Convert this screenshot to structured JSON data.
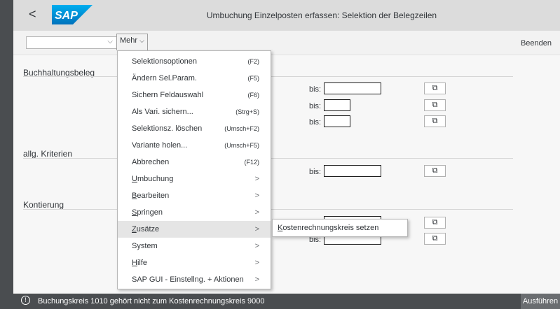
{
  "window": {
    "title": "Umbuchung Einzelposten erfassen: Selektion der Belegzeilen",
    "logo_text": "SAP"
  },
  "toolbar": {
    "dropdown_value": "",
    "mehr_label": "Mehr",
    "beenden_label": "Beenden"
  },
  "sections": {
    "buchhaltungsbeleg": "Buchhaltungsbeleg",
    "allg_kriterien": "allg. Kriterien",
    "kontierung": "Kontierung"
  },
  "bis_label": "bis:",
  "menu": {
    "items": [
      {
        "label": "Selektionsoptionen",
        "shortcut": "(F2)",
        "submenu": false,
        "mnemonic": ""
      },
      {
        "label": "Ändern Sel.Param.",
        "shortcut": "(F5)",
        "submenu": false,
        "mnemonic": ""
      },
      {
        "label": "Sichern Feldauswahl",
        "shortcut": "(F6)",
        "submenu": false,
        "mnemonic": ""
      },
      {
        "label": "Als Vari. sichern...",
        "shortcut": "(Strg+S)",
        "submenu": false,
        "mnemonic": ""
      },
      {
        "label": "Selektionsz. löschen",
        "shortcut": "(Umsch+F2)",
        "submenu": false,
        "mnemonic": ""
      },
      {
        "label": "Variante holen...",
        "shortcut": "(Umsch+F5)",
        "submenu": false,
        "mnemonic": ""
      },
      {
        "label": "Abbrechen",
        "shortcut": "(F12)",
        "submenu": false,
        "mnemonic": ""
      },
      {
        "label": "Umbuchung",
        "shortcut": "",
        "submenu": true,
        "mnemonic": "U"
      },
      {
        "label": "Bearbeiten",
        "shortcut": "",
        "submenu": true,
        "mnemonic": "B"
      },
      {
        "label": "Springen",
        "shortcut": "",
        "submenu": true,
        "mnemonic": "S"
      },
      {
        "label": "Zusätze",
        "shortcut": "",
        "submenu": true,
        "mnemonic": "Z",
        "highlighted": true
      },
      {
        "label": "System",
        "shortcut": "",
        "submenu": true,
        "mnemonic": "y"
      },
      {
        "label": "Hilfe",
        "shortcut": "",
        "submenu": true,
        "mnemonic": "H"
      },
      {
        "label": "SAP GUI - Einstellng. + Aktionen",
        "shortcut": "",
        "submenu": true,
        "mnemonic": ""
      }
    ],
    "submenu_item": "Kostenrechnungskreis setzen"
  },
  "status": {
    "message": "Buchungskreis 1010 gehört nicht zum Kostenrechnungskreis 9000",
    "run_label": "Ausführen"
  },
  "colors": {
    "status_bar": "#4a4d50",
    "title_bar": "#dcdcdc",
    "menu_highlight": "#e5e5e5"
  }
}
